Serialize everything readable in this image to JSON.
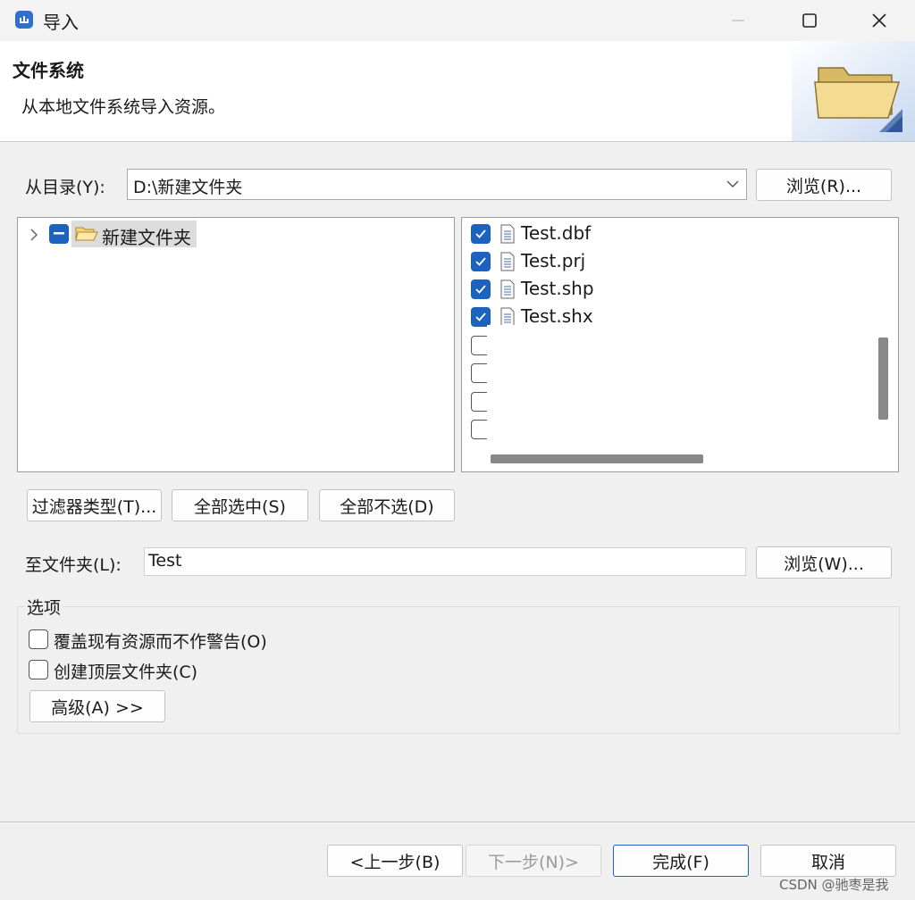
{
  "window": {
    "title": "导入",
    "icon": "dialog-app-icon",
    "controls": [
      "minimize-icon",
      "maximize-icon",
      "close-icon"
    ]
  },
  "banner": {
    "title": "文件系统",
    "description": "从本地文件系统导入资源。",
    "icon": "folder-icon"
  },
  "source": {
    "label": "从目录(Y):",
    "value": "D:\\新建文件夹",
    "browse_label": "浏览(R)..."
  },
  "tree": {
    "items": [
      {
        "label": "新建文件夹",
        "state": "partial",
        "icon": "folder-open-icon"
      }
    ]
  },
  "files": {
    "items": [
      {
        "name": "Test.dbf",
        "checked": true
      },
      {
        "name": "Test.prj",
        "checked": true
      },
      {
        "name": "Test.shp",
        "checked": true
      },
      {
        "name": "Test.shx",
        "checked": true
      },
      {
        "name": "",
        "checked": false
      },
      {
        "name": "",
        "checked": false
      },
      {
        "name": "",
        "checked": false
      },
      {
        "name": "",
        "checked": false
      }
    ]
  },
  "selection_buttons": {
    "filter": "过滤器类型(T)...",
    "select_all": "全部选中(S)",
    "deselect_all": "全部不选(D)"
  },
  "target": {
    "label": "至文件夹(L):",
    "value": "Test",
    "browse_label": "浏览(W)..."
  },
  "options": {
    "legend": "选项",
    "overwrite_label": "覆盖现有资源而不作警告(O)",
    "overwrite_checked": false,
    "create_top_label": "创建顶层文件夹(C)",
    "create_top_checked": false,
    "advanced_label": "高级(A) >>"
  },
  "footer": {
    "back": "<上一步(B)",
    "next": "下一步(N)>",
    "finish": "完成(F)",
    "cancel": "取消"
  },
  "watermark": "CSDN @驰枣是我"
}
